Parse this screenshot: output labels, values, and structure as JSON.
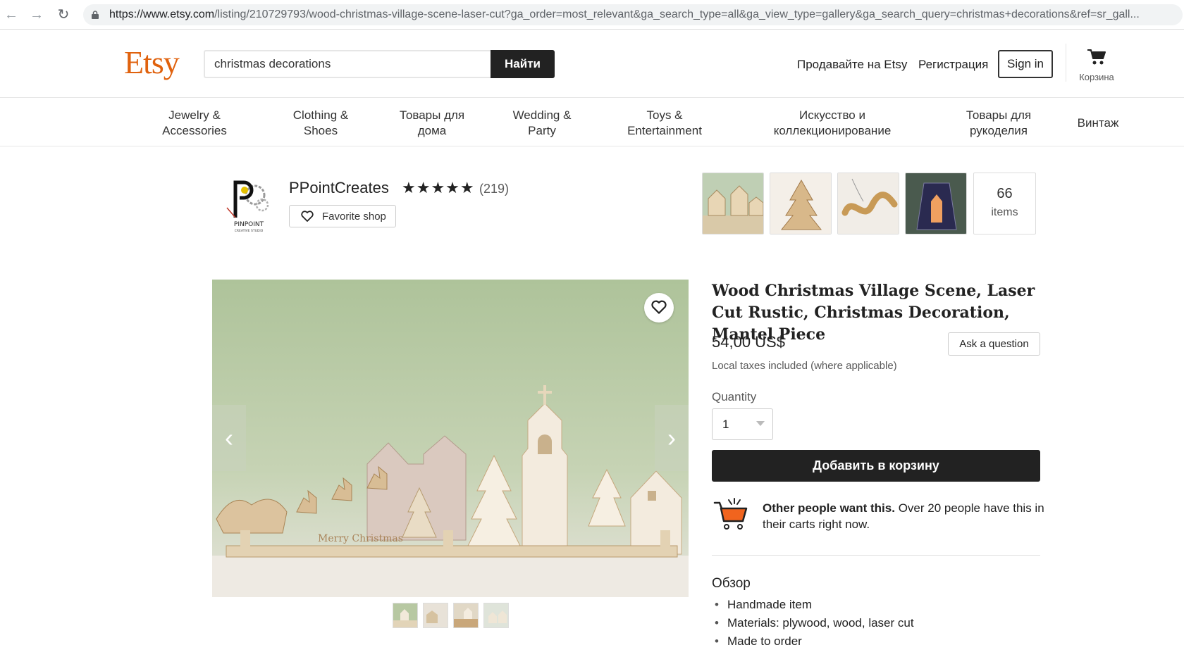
{
  "browser": {
    "url_domain": "https://www.etsy.com",
    "url_path": "/listing/210729793/wood-christmas-village-scene-laser-cut?ga_order=most_relevant&ga_search_type=all&ga_view_type=gallery&ga_search_query=christmas+decorations&ref=sr_gall..."
  },
  "header": {
    "logo": "Etsy",
    "search_value": "christmas decorations",
    "search_button": "Найти",
    "sell_link": "Продавайте на Etsy",
    "register_link": "Регистрация",
    "signin_button": "Sign in",
    "cart_label": "Корзина"
  },
  "categories": [
    {
      "line1": "Jewelry &",
      "line2": "Accessories"
    },
    {
      "line1": "Clothing &",
      "line2": "Shoes"
    },
    {
      "line1": "Товары для",
      "line2": "дома"
    },
    {
      "line1": "Wedding &",
      "line2": "Party"
    },
    {
      "line1": "Toys &",
      "line2": "Entertainment"
    },
    {
      "line1": "Искусство и",
      "line2": "коллекционирование"
    },
    {
      "line1": "Товары для",
      "line2": "рукоделия"
    },
    {
      "line1": "Винтаж",
      "line2": ""
    }
  ],
  "shop": {
    "logo_text": "PINPOINT",
    "logo_subtext": "CREATIVE STUDIO",
    "name": "PPointCreates",
    "stars": "★★★★★",
    "rating": 5,
    "reviews": "(219)",
    "favorite_button": "Favorite shop",
    "item_count": "66",
    "item_count_label": "items"
  },
  "listing": {
    "title": "Wood Christmas Village Scene, Laser Cut Rustic, Christmas Decoration, Mantel Piece",
    "price": "54,00 US$",
    "ask_button": "Ask a question",
    "tax_note": "Local taxes included (where applicable)",
    "quantity_label": "Quantity",
    "quantity_value": "1",
    "add_to_cart": "Добавить в корзину",
    "demand_bold": "Other people want this.",
    "demand_rest": " Over 20 people have this in their carts right now.",
    "overview_title": "Обзор",
    "overview_items": [
      "Handmade item",
      "Materials: plywood, wood, laser cut",
      "Made to order"
    ],
    "image_sign_text": "Merry Christmas"
  },
  "colors": {
    "brand": "#e0620e",
    "button_dark": "#222222",
    "image_bg": "#b9c9a6"
  }
}
